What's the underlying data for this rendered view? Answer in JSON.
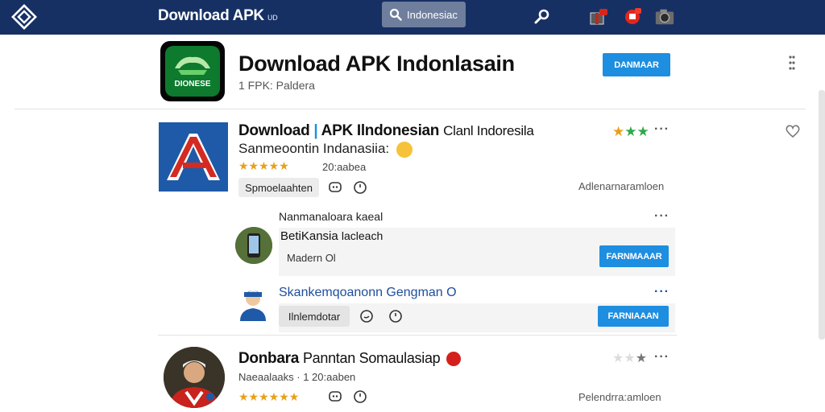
{
  "topbar": {
    "app_name": "Download APK",
    "app_name_sub": "ᴜᴅ",
    "search_label": "Indonesiac",
    "icons": [
      "diamond-logo-icon",
      "search-icon",
      "wrench-icon",
      "gift-icon",
      "notification-icon",
      "camera-icon"
    ]
  },
  "hero": {
    "icon_text": "DIONESE",
    "title": "Download APK Indonlasain",
    "subtitle": "1 FPK: Paldera",
    "button": "DANMAAR"
  },
  "listing1": {
    "title_bold": "Download",
    "title_rest": "APK Ilndonesian",
    "title_tail": "Clanl Indoresila",
    "subtitle": "Sanmeoontin Indanasiia:",
    "stars": "★★★★★",
    "count": "20:aabea",
    "tag": "Spmoelaahten",
    "side": "Adlenarnaramloen",
    "rating_stars": "★★★"
  },
  "sub1": {
    "heading": "Nanmanaloara kaeal",
    "name": "BetiKansia",
    "name_tail": "lacleach",
    "meta": "Madern  Ol",
    "button": "FARNMAAAR"
  },
  "sub2": {
    "title": "Skankemqoanonn Gengman O",
    "tag": "Ilnlemdotar",
    "button": "FARNIAAAN"
  },
  "listing2": {
    "title_a": "Donbara",
    "title_b": "Panntan Somaulasiap",
    "meta": "Naeaalaaks · 1  20:aaben",
    "stars": "★★★★★★",
    "side": "Pelendrra:amloen"
  }
}
